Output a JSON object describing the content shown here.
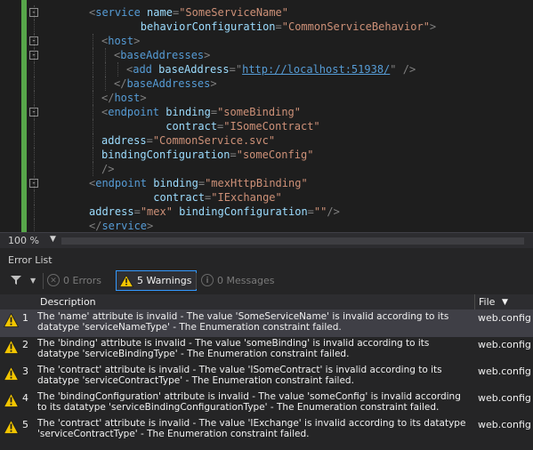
{
  "editor": {
    "lines": [
      {
        "fold": "-",
        "indent": 0,
        "tokens": [
          [
            "b",
            "<"
          ],
          [
            "n",
            "service"
          ],
          [
            "p",
            " "
          ],
          [
            "a",
            "name"
          ],
          [
            "b",
            "="
          ],
          [
            "v",
            "\"SomeServiceName\""
          ]
        ]
      },
      {
        "fold": "",
        "indent": 0,
        "tokens": [
          [
            "p",
            "        "
          ],
          [
            "a",
            "behaviorConfiguration"
          ],
          [
            "b",
            "="
          ],
          [
            "v",
            "\"CommonServiceBehavior\""
          ],
          [
            "b",
            ">"
          ]
        ]
      },
      {
        "fold": "-",
        "indent": 1,
        "tokens": [
          [
            "b",
            "<"
          ],
          [
            "n",
            "host"
          ],
          [
            "b",
            ">"
          ]
        ]
      },
      {
        "fold": "-",
        "indent": 2,
        "tokens": [
          [
            "b",
            "<"
          ],
          [
            "n",
            "baseAddresses"
          ],
          [
            "b",
            ">"
          ]
        ]
      },
      {
        "fold": "",
        "indent": 3,
        "tokens": [
          [
            "b",
            "<"
          ],
          [
            "n",
            "add"
          ],
          [
            "p",
            " "
          ],
          [
            "a",
            "baseAddress"
          ],
          [
            "b",
            "="
          ],
          [
            "b",
            "\""
          ],
          [
            "u",
            "http://localhost:51938/"
          ],
          [
            "b",
            "\""
          ],
          [
            "p",
            " "
          ],
          [
            "b",
            "/>"
          ]
        ]
      },
      {
        "fold": "",
        "indent": 2,
        "tokens": [
          [
            "b",
            "</"
          ],
          [
            "n",
            "baseAddresses"
          ],
          [
            "b",
            ">"
          ]
        ]
      },
      {
        "fold": "",
        "indent": 1,
        "tokens": [
          [
            "b",
            "</"
          ],
          [
            "n",
            "host"
          ],
          [
            "b",
            ">"
          ]
        ]
      },
      {
        "fold": "-",
        "indent": 1,
        "tokens": [
          [
            "b",
            "<"
          ],
          [
            "n",
            "endpoint"
          ],
          [
            "p",
            " "
          ],
          [
            "a",
            "binding"
          ],
          [
            "b",
            "="
          ],
          [
            "v",
            "\"someBinding\""
          ]
        ]
      },
      {
        "fold": "",
        "indent": 1,
        "tokens": [
          [
            "p",
            "          "
          ],
          [
            "a",
            "contract"
          ],
          [
            "b",
            "="
          ],
          [
            "v",
            "\"ISomeContract\""
          ]
        ]
      },
      {
        "fold": "",
        "indent": 1,
        "tokens": [
          [
            "a",
            "address"
          ],
          [
            "b",
            "="
          ],
          [
            "v",
            "\"CommonService.svc\""
          ]
        ]
      },
      {
        "fold": "",
        "indent": 1,
        "tokens": [
          [
            "a",
            "bindingConfiguration"
          ],
          [
            "b",
            "="
          ],
          [
            "v",
            "\"someConfig\""
          ]
        ]
      },
      {
        "fold": "",
        "indent": 1,
        "tokens": [
          [
            "b",
            "/>"
          ]
        ]
      },
      {
        "fold": "-",
        "indent": 0,
        "tokens": [
          [
            "b",
            "<"
          ],
          [
            "n",
            "endpoint"
          ],
          [
            "p",
            " "
          ],
          [
            "a",
            "binding"
          ],
          [
            "b",
            "="
          ],
          [
            "v",
            "\"mexHttpBinding\""
          ]
        ]
      },
      {
        "fold": "",
        "indent": 0,
        "tokens": [
          [
            "p",
            "          "
          ],
          [
            "a",
            "contract"
          ],
          [
            "b",
            "="
          ],
          [
            "v",
            "\"IExchange\""
          ]
        ]
      },
      {
        "fold": "",
        "indent": 0,
        "tokens": [
          [
            "a",
            "address"
          ],
          [
            "b",
            "="
          ],
          [
            "v",
            "\"mex\""
          ],
          [
            "p",
            " "
          ],
          [
            "a",
            "bindingConfiguration"
          ],
          [
            "b",
            "="
          ],
          [
            "v",
            "\"\""
          ],
          [
            "b",
            "/>"
          ]
        ]
      },
      {
        "fold": "",
        "indent": 0,
        "tokens": [
          [
            "b",
            "</"
          ],
          [
            "n",
            "service"
          ],
          [
            "b",
            ">"
          ]
        ]
      }
    ]
  },
  "zoom": {
    "label": "100 %"
  },
  "error_list": {
    "title": "Error List",
    "errors_label": "0 Errors",
    "warnings_label": "5 Warnings",
    "messages_label": "0 Messages",
    "col_description": "Description",
    "col_file": "File",
    "rows": [
      {
        "num": "1",
        "desc": "The 'name' attribute is invalid - The value 'SomeServiceName' is invalid according to its datatype 'serviceNameType' - The Enumeration constraint failed.",
        "file": "web.config"
      },
      {
        "num": "2",
        "desc": "The 'binding' attribute is invalid - The value 'someBinding' is invalid according to its datatype 'serviceBindingType' - The Enumeration constraint failed.",
        "file": "web.config"
      },
      {
        "num": "3",
        "desc": "The 'contract' attribute is invalid - The value 'ISomeContract' is invalid according to its datatype 'serviceContractType' - The Enumeration constraint failed.",
        "file": "web.config"
      },
      {
        "num": "4",
        "desc": "The 'bindingConfiguration' attribute is invalid - The value 'someConfig' is invalid according to its datatype 'serviceBindingConfigurationType' - The Enumeration constraint failed.",
        "file": "web.config"
      },
      {
        "num": "5",
        "desc": "The 'contract' attribute is invalid - The value 'IExchange' is invalid according to its datatype 'serviceContractType' - The Enumeration constraint failed.",
        "file": "web.config"
      }
    ]
  },
  "colors": {
    "accent": "#3399ff",
    "gutter": "#57a64a",
    "warning": "#f2c500"
  }
}
